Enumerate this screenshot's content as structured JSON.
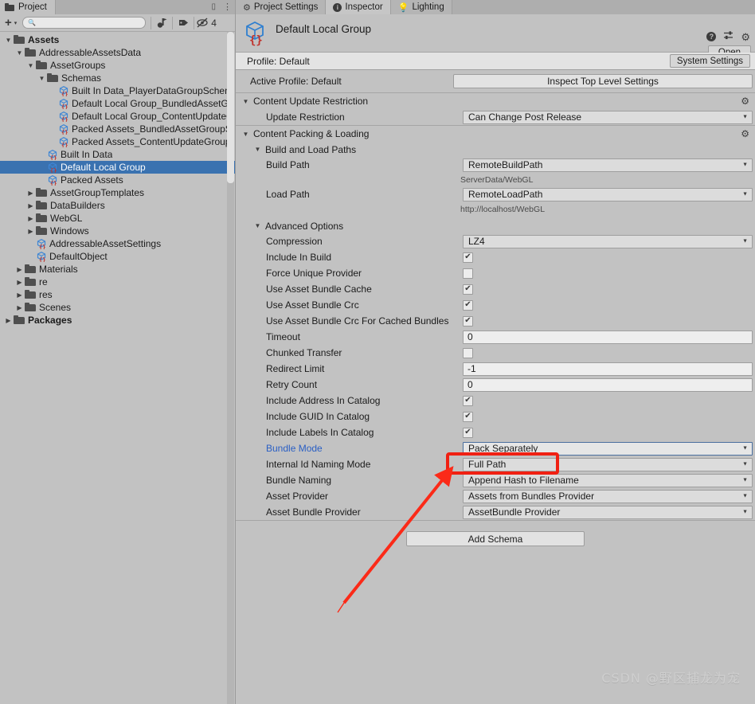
{
  "project_panel": {
    "tab_label": "Project",
    "tab_icon": "folder-icon",
    "window_buttons": [
      "maximize-icon",
      "kebab-menu-icon"
    ],
    "toolbar": {
      "add_label": "+",
      "add_caret": "▾",
      "search_placeholder": "",
      "search_value": "",
      "search_icon": "search-icon",
      "icons": [
        "asset-save-filter-icon",
        "label-filter-icon",
        "hidden-items-icon"
      ],
      "hidden_count": "4"
    },
    "tree": [
      {
        "label": "Assets",
        "depth": 0,
        "icon": "folder-icon",
        "twisty": "▼",
        "bold": true,
        "selected": false
      },
      {
        "label": "AddressableAssetsData",
        "depth": 1,
        "icon": "folder-icon",
        "twisty": "▼",
        "bold": false,
        "selected": false
      },
      {
        "label": "AssetGroups",
        "depth": 2,
        "icon": "folder-icon",
        "twisty": "▼",
        "bold": false,
        "selected": false
      },
      {
        "label": "Schemas",
        "depth": 3,
        "icon": "folder-icon",
        "twisty": "▼",
        "bold": false,
        "selected": false
      },
      {
        "label": "Built In Data_PlayerDataGroupSchema",
        "depth": 4,
        "icon": "scriptable-object-icon",
        "twisty": "",
        "bold": false,
        "selected": false
      },
      {
        "label": "Default Local Group_BundledAssetGroupSchema",
        "depth": 4,
        "icon": "scriptable-object-icon",
        "twisty": "",
        "bold": false,
        "selected": false
      },
      {
        "label": "Default Local Group_ContentUpdateGroupSchema",
        "depth": 4,
        "icon": "scriptable-object-icon",
        "twisty": "",
        "bold": false,
        "selected": false
      },
      {
        "label": "Packed Assets_BundledAssetGroupSchema",
        "depth": 4,
        "icon": "scriptable-object-icon",
        "twisty": "",
        "bold": false,
        "selected": false
      },
      {
        "label": "Packed Assets_ContentUpdateGroupSchema",
        "depth": 4,
        "icon": "scriptable-object-icon",
        "twisty": "",
        "bold": false,
        "selected": false
      },
      {
        "label": "Built In Data",
        "depth": 3,
        "icon": "scriptable-object-icon",
        "twisty": "",
        "bold": false,
        "selected": false
      },
      {
        "label": "Default Local Group",
        "depth": 3,
        "icon": "scriptable-object-icon",
        "twisty": "",
        "bold": false,
        "selected": true
      },
      {
        "label": "Packed Assets",
        "depth": 3,
        "icon": "scriptable-object-icon",
        "twisty": "",
        "bold": false,
        "selected": false
      },
      {
        "label": "AssetGroupTemplates",
        "depth": 2,
        "icon": "folder-icon",
        "twisty": "▶",
        "bold": false,
        "selected": false
      },
      {
        "label": "DataBuilders",
        "depth": 2,
        "icon": "folder-icon",
        "twisty": "▶",
        "bold": false,
        "selected": false
      },
      {
        "label": "WebGL",
        "depth": 2,
        "icon": "folder-icon",
        "twisty": "▶",
        "bold": false,
        "selected": false
      },
      {
        "label": "Windows",
        "depth": 2,
        "icon": "folder-icon",
        "twisty": "▶",
        "bold": false,
        "selected": false
      },
      {
        "label": "AddressableAssetSettings",
        "depth": 2,
        "icon": "scriptable-object-icon",
        "twisty": "",
        "bold": false,
        "selected": false
      },
      {
        "label": "DefaultObject",
        "depth": 2,
        "icon": "scriptable-object-icon",
        "twisty": "",
        "bold": false,
        "selected": false
      },
      {
        "label": "Materials",
        "depth": 1,
        "icon": "folder-icon",
        "twisty": "▶",
        "bold": false,
        "selected": false
      },
      {
        "label": "re",
        "depth": 1,
        "icon": "folder-icon",
        "twisty": "▶",
        "bold": false,
        "selected": false
      },
      {
        "label": "res",
        "depth": 1,
        "icon": "folder-icon",
        "twisty": "▶",
        "bold": false,
        "selected": false
      },
      {
        "label": "Scenes",
        "depth": 1,
        "icon": "folder-icon",
        "twisty": "▶",
        "bold": false,
        "selected": false
      },
      {
        "label": "Packages",
        "depth": 0,
        "icon": "folder-icon",
        "twisty": "▶",
        "bold": true,
        "selected": false
      }
    ]
  },
  "inspector": {
    "tabs": [
      {
        "label": "Project Settings",
        "icon": "gear-icon",
        "active": false
      },
      {
        "label": "Inspector",
        "icon": "info-icon",
        "active": true
      },
      {
        "label": "Lighting",
        "icon": "lightbulb-icon",
        "active": false
      }
    ],
    "header": {
      "title": "Default Local Group",
      "icon": "scriptable-object-icon",
      "icons": [
        "help-icon",
        "preset-icon",
        "gear-icon"
      ],
      "open_label": "Open"
    },
    "profile_row": {
      "label": "Profile: Default",
      "system_settings_label": "System Settings"
    },
    "active_profile_row": {
      "label": "Active Profile: Default",
      "inspect_button_label": "Inspect Top Level Settings"
    },
    "sections": [
      {
        "title": "Content Update Restriction",
        "twisty": "▼",
        "gear": "gear-icon",
        "rows": [
          {
            "label": "Update Restriction",
            "type": "dropdown",
            "value": "Can Change Post Release"
          }
        ]
      },
      {
        "title": "Content Packing & Loading",
        "twisty": "▼",
        "gear": "gear-icon",
        "subsection": {
          "title": "Build and Load Paths",
          "twisty": "▼"
        },
        "rows": [
          {
            "label": "Build Path",
            "type": "dropdown",
            "value": "RemoteBuildPath",
            "subvalue": "ServerData/WebGL"
          },
          {
            "label": "Load Path",
            "type": "dropdown",
            "value": "RemoteLoadPath",
            "subvalue": "http://localhost/WebGL"
          }
        ],
        "advanced": {
          "title": "Advanced Options",
          "twisty": "▼",
          "rows": [
            {
              "label": "Compression",
              "type": "dropdown",
              "value": "LZ4"
            },
            {
              "label": "Include In Build",
              "type": "checkbox",
              "checked": true
            },
            {
              "label": "Force Unique Provider",
              "type": "checkbox",
              "checked": false
            },
            {
              "label": "Use Asset Bundle Cache",
              "type": "checkbox",
              "checked": true
            },
            {
              "label": "Use Asset Bundle Crc",
              "type": "checkbox",
              "checked": true
            },
            {
              "label": "Use Asset Bundle Crc For Cached Bundles",
              "type": "checkbox",
              "checked": true
            },
            {
              "label": "Timeout",
              "type": "text",
              "value": "0"
            },
            {
              "label": "Chunked Transfer",
              "type": "checkbox",
              "checked": false
            },
            {
              "label": "Redirect Limit",
              "type": "text",
              "value": "-1"
            },
            {
              "label": "Retry Count",
              "type": "text",
              "value": "0"
            },
            {
              "label": "Include Address In Catalog",
              "type": "checkbox",
              "checked": true
            },
            {
              "label": "Include GUID In Catalog",
              "type": "checkbox",
              "checked": true
            },
            {
              "label": "Include Labels In Catalog",
              "type": "checkbox",
              "checked": true
            },
            {
              "label": "Bundle Mode",
              "type": "dropdown",
              "value": "Pack Separately",
              "link": true,
              "focused": true
            },
            {
              "label": "Internal Id Naming Mode",
              "type": "dropdown",
              "value": "Full Path"
            },
            {
              "label": "Bundle Naming",
              "type": "dropdown",
              "value": "Append Hash to Filename"
            },
            {
              "label": "Asset Provider",
              "type": "dropdown",
              "value": "Assets from Bundles Provider"
            },
            {
              "label": "Asset Bundle Provider",
              "type": "dropdown",
              "value": "AssetBundle Provider"
            }
          ]
        }
      }
    ],
    "add_schema_label": "Add Schema"
  },
  "annotations": {
    "highlight_color": "#f02012",
    "arrow_color": "#fb2a18",
    "highlight_target": "bundle-mode-dropdown",
    "arrow_tooltip": "points at Bundle Mode value"
  },
  "watermark": "CSDN @野区捕龙为宠"
}
